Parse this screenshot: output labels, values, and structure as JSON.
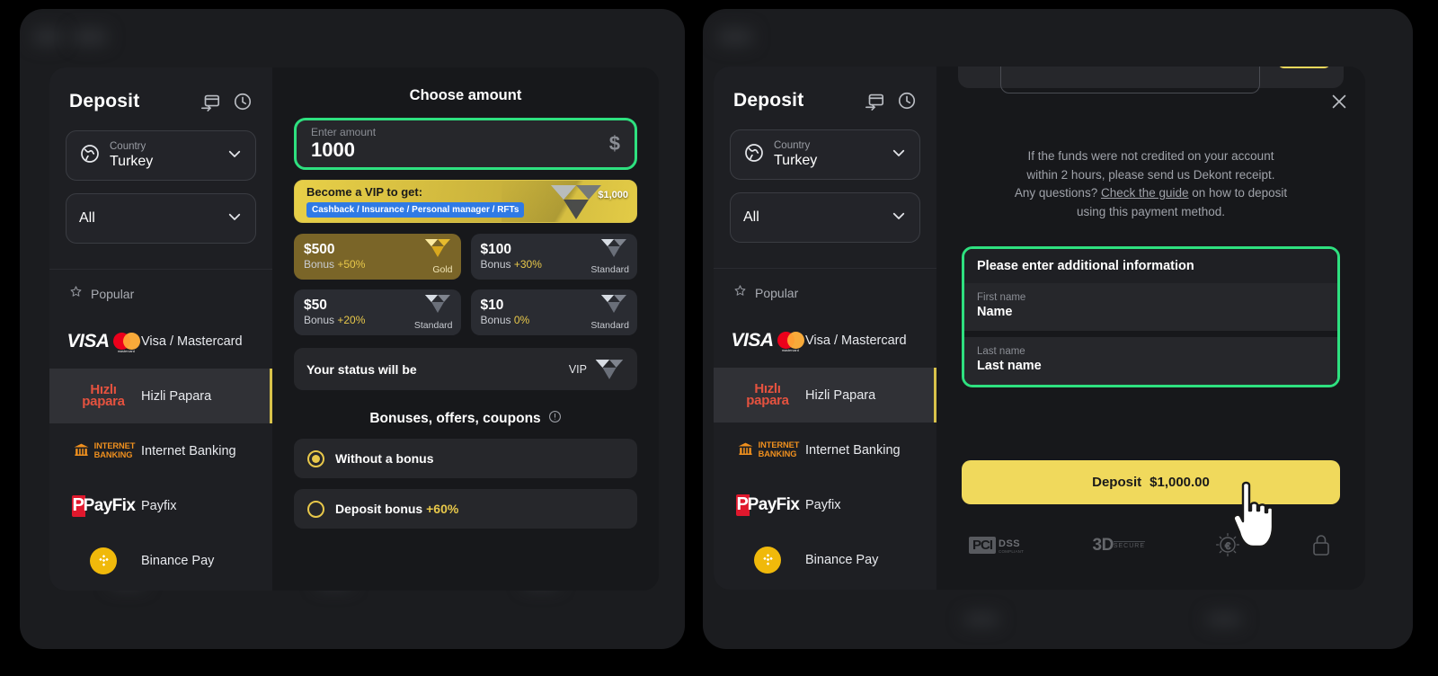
{
  "left_panel": {
    "sidebar": {
      "title": "Deposit",
      "icons": [
        {
          "name": "card-transfer-icon"
        },
        {
          "name": "history-clock-icon"
        }
      ],
      "country_field": {
        "label": "Country",
        "value": "Turkey",
        "icon": "globe-icon"
      },
      "filter_field": {
        "value": "All",
        "icon": "chevron-down-icon"
      },
      "section_label": "Popular",
      "section_icon": "star-icon",
      "methods": [
        {
          "name": "Visa / Mastercard",
          "logo": "visa-mastercard-logo",
          "active": false
        },
        {
          "name": "Hizli Papara",
          "logo": "hizli-papara-logo",
          "active": true
        },
        {
          "name": "Internet Banking",
          "logo": "internet-banking-logo",
          "active": false
        },
        {
          "name": "Payfix",
          "logo": "payfix-logo",
          "active": false
        },
        {
          "name": "Binance Pay",
          "logo": "binance-pay-logo",
          "active": false
        }
      ]
    },
    "content": {
      "title": "Choose amount",
      "amount_input": {
        "label": "Enter amount",
        "value": "1000",
        "placeholder": "Enter amount",
        "currency_symbol": "$",
        "highlight_color": "#2ee07f"
      },
      "vip_banner": {
        "headline": "Become a VIP to get:",
        "tag": "Cashback / Insurance / Personal manager / RFTs",
        "price": "$1,000"
      },
      "presets": [
        {
          "amount": "$500",
          "bonus_prefix": "Bonus ",
          "bonus": "+50%",
          "tier": "Gold",
          "style": "gold"
        },
        {
          "amount": "$100",
          "bonus_prefix": "Bonus ",
          "bonus": "+30%",
          "tier": "Standard",
          "style": "standard"
        },
        {
          "amount": "$50",
          "bonus_prefix": "Bonus ",
          "bonus": "+20%",
          "tier": "Standard",
          "style": "standard"
        },
        {
          "amount": "$10",
          "bonus_prefix": "Bonus ",
          "bonus": "0%",
          "tier": "Standard",
          "style": "standard"
        }
      ],
      "status": {
        "label": "Your status will be",
        "value": "VIP"
      },
      "bonus_section": {
        "title": "Bonuses, offers, coupons",
        "info_icon": "info-circle-icon",
        "options": [
          {
            "label": "Without a bonus",
            "highlight": "",
            "selected": true
          },
          {
            "label": "Deposit bonus ",
            "highlight": "+60%",
            "selected": false
          }
        ]
      }
    }
  },
  "right_panel": {
    "sidebar": {
      "title": "Deposit",
      "country_field": {
        "label": "Country",
        "value": "Turkey"
      },
      "filter_field": {
        "value": "All"
      },
      "section_label": "Popular",
      "methods": [
        {
          "name": "Visa / Mastercard",
          "logo": "visa-mastercard-logo",
          "active": false
        },
        {
          "name": "Hizli Papara",
          "logo": "hizli-papara-logo",
          "active": true
        },
        {
          "name": "Internet Banking",
          "logo": "internet-banking-logo",
          "active": false
        },
        {
          "name": "Payfix",
          "logo": "payfix-logo",
          "active": false
        },
        {
          "name": "Binance Pay",
          "logo": "binance-pay-logo",
          "active": false
        }
      ]
    },
    "content": {
      "close_icon": "close-icon",
      "helper_line1": "If the funds were not credited on your account",
      "helper_line2": "within 2 hours, please send us Dekont receipt.",
      "helper_line3_pre": "Any questions? ",
      "helper_link": "Check the guide",
      "helper_line3_post": " on how to deposit",
      "helper_line4": "using this payment method.",
      "additional_info": {
        "title": "Please enter additional information",
        "highlight_color": "#2ee07f",
        "fields": [
          {
            "label": "First name",
            "value": "Name",
            "placeholder": "Name"
          },
          {
            "label": "Last name",
            "value": "Last name",
            "placeholder": "Last name"
          }
        ]
      },
      "deposit_button": {
        "label": "Deposit",
        "amount": "$1,000.00",
        "color": "#f0d95c"
      },
      "badges": [
        {
          "name": "pci-dss-badge",
          "text": "PCI",
          "sub": "DSS",
          "caption": "COMPLIANT"
        },
        {
          "name": "3d-secure-badge",
          "text": "3D",
          "sub": "SECURE"
        },
        {
          "name": "euro-secure-badge",
          "text": "€"
        },
        {
          "name": "lock-badge",
          "text": ""
        }
      ]
    }
  }
}
